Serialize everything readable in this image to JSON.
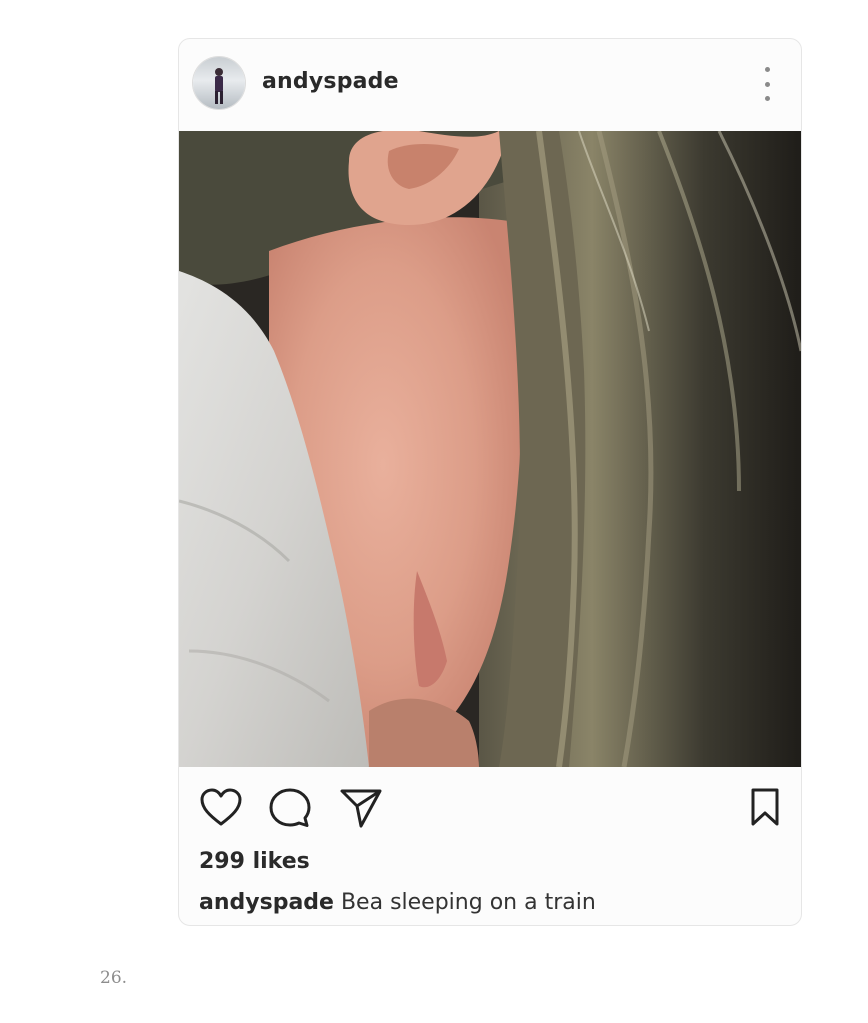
{
  "post": {
    "username": "andyspade",
    "likes": "299 likes",
    "caption_user": "andyspade",
    "caption_text": "Bea sleeping on a train"
  },
  "page": {
    "item_number": "26."
  },
  "icons": {
    "more": "more-vertical-icon",
    "like": "heart-icon",
    "comment": "comment-icon",
    "share": "send-icon",
    "save": "bookmark-icon"
  },
  "colors": {
    "background": "#ffffff",
    "card": "#fcfcfc",
    "text": "#2a2a2a",
    "icon": "#222222"
  }
}
